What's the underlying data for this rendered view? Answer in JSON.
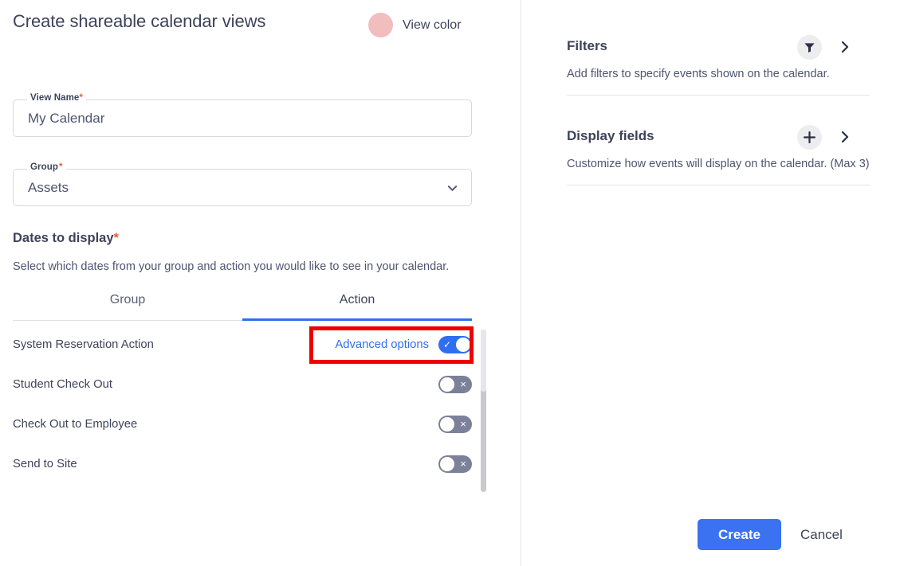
{
  "header": {
    "title": "Create shareable calendar views",
    "view_color_label": "View color",
    "view_color_hex": "#f2bdbd"
  },
  "form": {
    "view_name": {
      "label": "View Name",
      "required_mark": "*",
      "value": "My Calendar"
    },
    "group": {
      "label": "Group",
      "required_mark": "*",
      "value": "Assets",
      "chevron_icon": "chevron-down-icon"
    }
  },
  "dates_section": {
    "heading": "Dates to display",
    "required_mark": "*",
    "description": "Select which dates from your group and action you would like to see in your calendar.",
    "tabs": [
      {
        "label": "Group",
        "active": false
      },
      {
        "label": "Action",
        "active": true
      }
    ],
    "rows": [
      {
        "label": "System Reservation Action",
        "advanced_label": "Advanced options",
        "toggle_state": "on",
        "toggle_mark": "✓",
        "highlighted": true
      },
      {
        "label": "Student Check Out",
        "advanced_label": "",
        "toggle_state": "off",
        "toggle_mark": "×",
        "highlighted": false
      },
      {
        "label": "Check Out to Employee",
        "advanced_label": "",
        "toggle_state": "off",
        "toggle_mark": "×",
        "highlighted": false
      },
      {
        "label": "Send to Site",
        "advanced_label": "",
        "toggle_state": "off",
        "toggle_mark": "×",
        "highlighted": false
      }
    ]
  },
  "side_panel": {
    "filters": {
      "title": "Filters",
      "description": "Add filters to specify events shown on the calendar.",
      "icon": "funnel-icon",
      "chevron_icon": "chevron-right-icon"
    },
    "display_fields": {
      "title": "Display fields",
      "description": "Customize how events will display on the calendar. (Max 3)",
      "icon": "plus-icon",
      "chevron_icon": "chevron-right-icon"
    }
  },
  "footer": {
    "create_label": "Create",
    "cancel_label": "Cancel",
    "create_color": "#3b72f2"
  },
  "annotation": {
    "box_color": "#ef0000"
  }
}
